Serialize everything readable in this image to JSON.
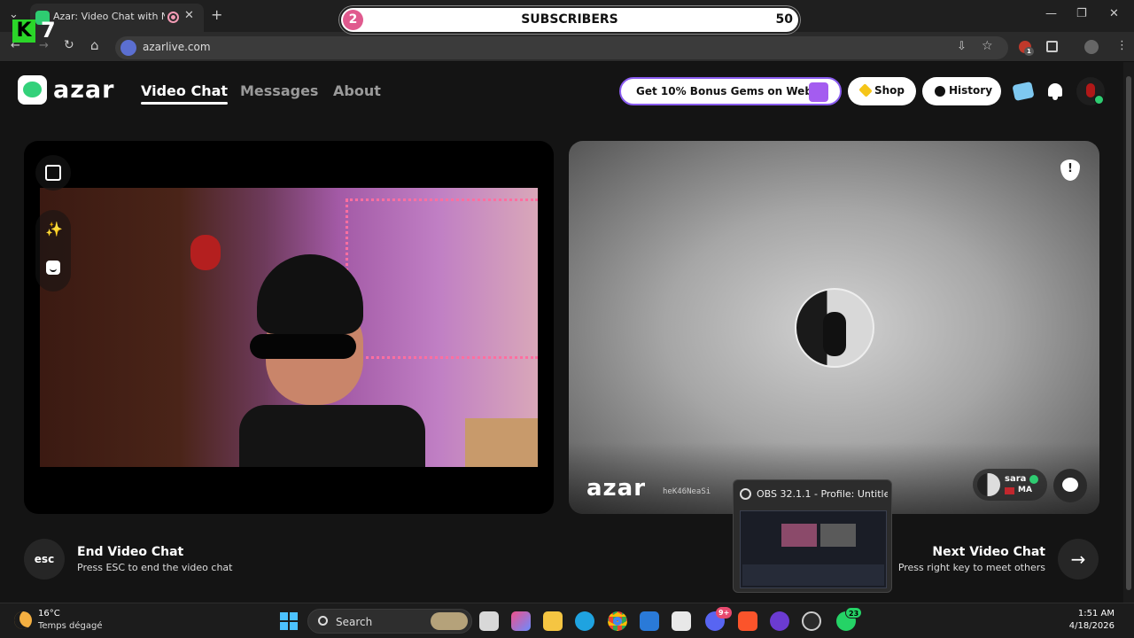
{
  "browser": {
    "tab_title": "Azar: Video Chat with New",
    "new_tab_symbol": "+",
    "close_symbol": "✕",
    "url": "azarlive.com",
    "window_min": "—",
    "window_max": "❐",
    "window_close": "✕",
    "nav_back": "←",
    "nav_forward": "→",
    "reload": "↻",
    "home": "⌂",
    "star": "☆",
    "tab_list": "⌄",
    "ext_badge": "1"
  },
  "overlay": {
    "subscriber_count": "2",
    "label": "SUBSCRIBERS",
    "goal": "50",
    "channel_letter": "K",
    "channel_number": "7"
  },
  "header": {
    "logo_text": "azar",
    "nav": {
      "video_chat": "Video Chat",
      "messages": "Messages",
      "about": "About"
    },
    "promo": "Get 10% Bonus Gems on Web!",
    "shop": "Shop",
    "history": "History"
  },
  "local_video": {
    "magic_symbol": "✨"
  },
  "remote_video": {
    "report_symbol": "!",
    "watermark": "azar",
    "watermark_id": "heK46NeaSi",
    "partner_name": "sara",
    "partner_country": "MA"
  },
  "controls": {
    "end_key": "esc",
    "end_title": "End Video Chat",
    "end_subtitle": "Press ESC to end the video chat",
    "next_title": "Next Video Chat",
    "next_subtitle": "Press right key to meet others",
    "next_arrow": "→"
  },
  "obs_preview": {
    "title": "OBS 32.1.1 - Profile: Untitle..."
  },
  "taskbar": {
    "temperature": "16°C",
    "weather": "Temps dégagé",
    "search_placeholder": "Search",
    "discord_badge": "9+",
    "whatsapp_badge": "23",
    "time": "1:51 AM",
    "date": "4/18/2026"
  },
  "colors": {
    "accent_green": "#33d17a",
    "promo_border": "#8a5cf0",
    "background": "#141414",
    "overlay_badge": "#e05a8e"
  }
}
